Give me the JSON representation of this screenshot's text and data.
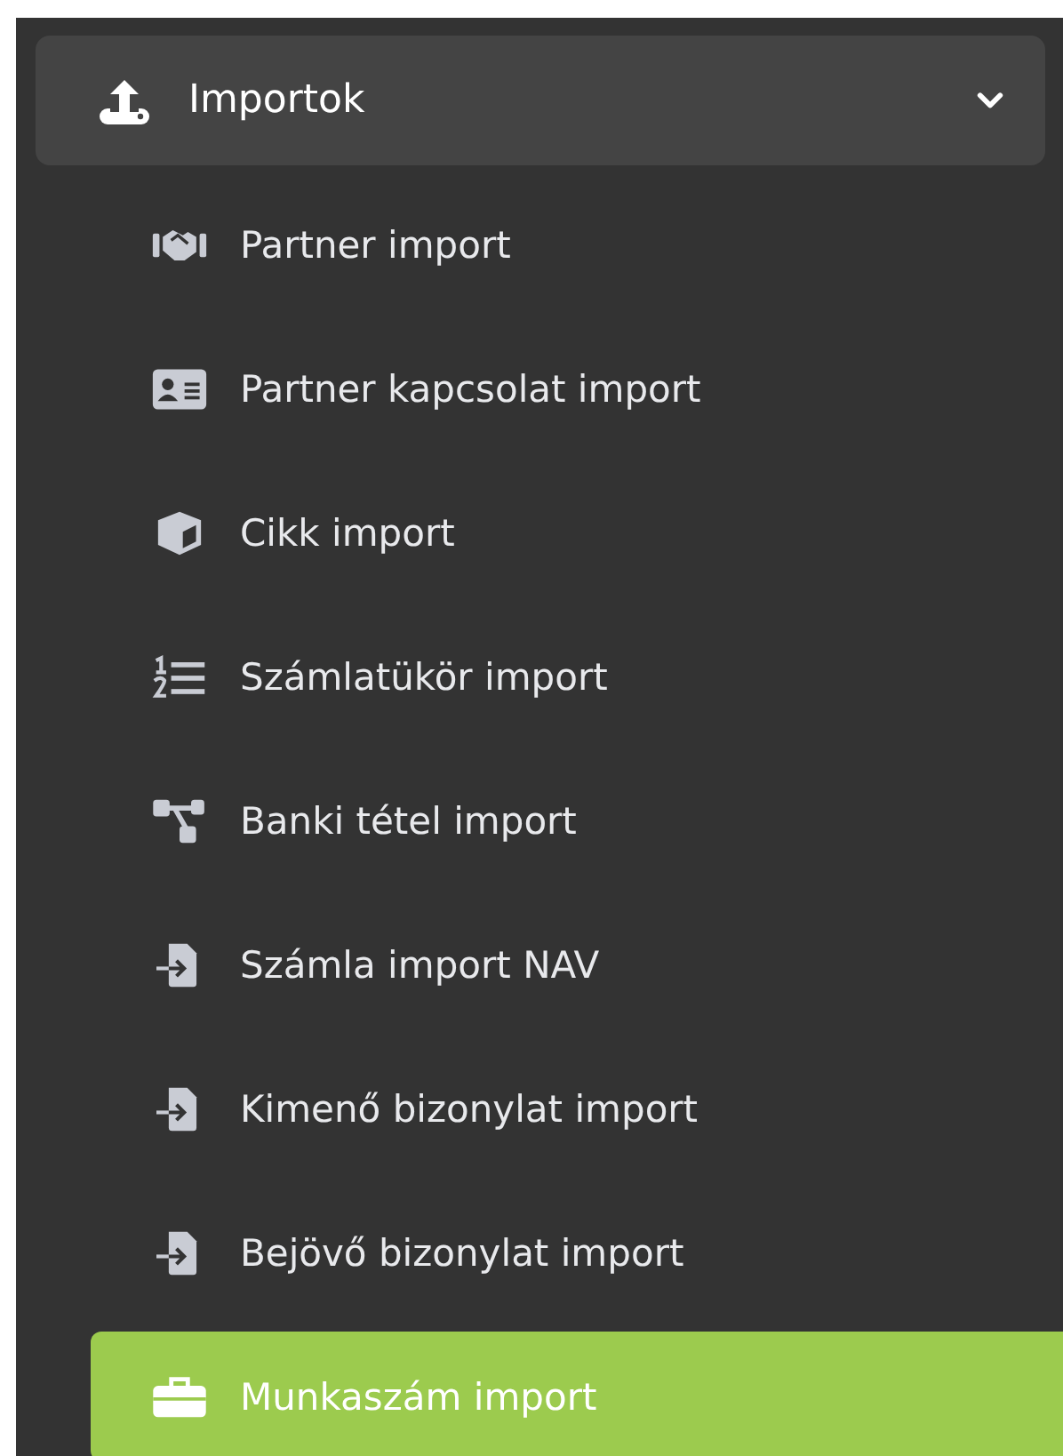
{
  "menu": {
    "title": "Importok",
    "expanded": true,
    "items": [
      {
        "label": "Partner import",
        "kind": "handshake",
        "selected": false
      },
      {
        "label": "Partner kapcsolat import",
        "kind": "idcard",
        "selected": false
      },
      {
        "label": "Cikk import",
        "kind": "cube",
        "selected": false
      },
      {
        "label": "Számlatükör import",
        "kind": "numlist",
        "selected": false
      },
      {
        "label": "Banki tétel import",
        "kind": "tree",
        "selected": false
      },
      {
        "label": "Számla import NAV",
        "kind": "fileimport",
        "selected": false
      },
      {
        "label": "Kimenő bizonylat import",
        "kind": "fileimport",
        "selected": false
      },
      {
        "label": "Bejövő bizonylat import",
        "kind": "fileimport",
        "selected": false
      },
      {
        "label": "Munkaszám import",
        "kind": "briefcase",
        "selected": true
      }
    ]
  }
}
